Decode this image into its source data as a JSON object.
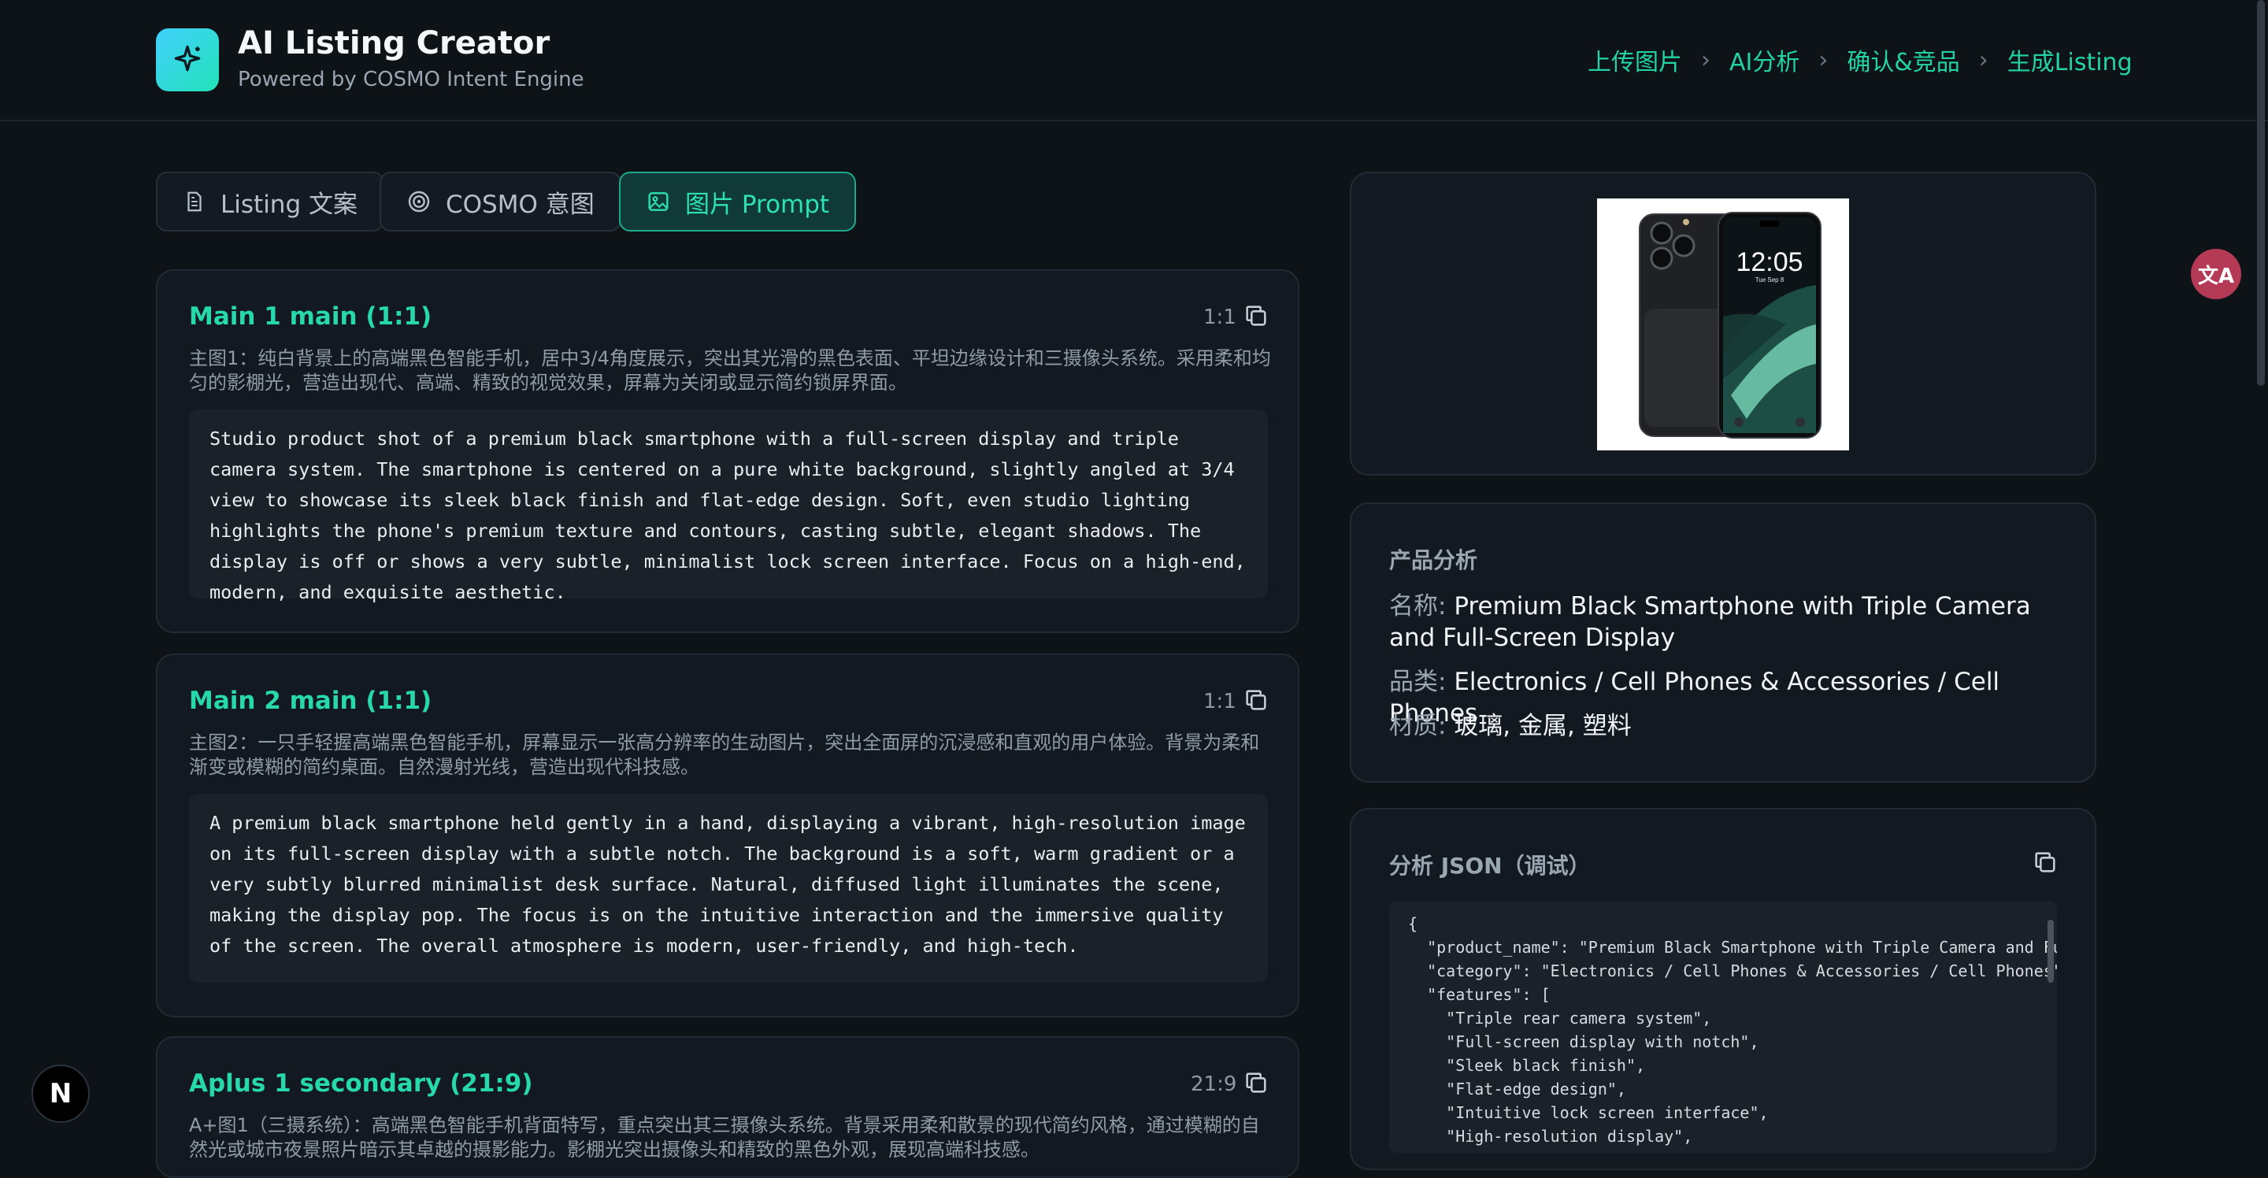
{
  "header": {
    "title": "AI Listing Creator",
    "subtitle": "Powered by COSMO Intent Engine",
    "steps": [
      "上传图片",
      "AI分析",
      "确认&竞品",
      "生成Listing"
    ]
  },
  "tabs": [
    {
      "label": "Listing 文案",
      "icon": "document-icon"
    },
    {
      "label": "COSMO 意图",
      "icon": "target-icon"
    },
    {
      "label": "图片 Prompt",
      "icon": "image-icon",
      "active": true
    }
  ],
  "prompts": [
    {
      "title": "Main 1 main (1:1)",
      "ratio": "1:1",
      "zh": "主图1：纯白背景上的高端黑色智能手机，居中3/4角度展示，突出其光滑的黑色表面、平坦边缘设计和三摄像头系统。采用柔和均匀的影棚光，营造出现代、高端、精致的视觉效果，屏幕为关闭或显示简约锁屏界面。",
      "en": "Studio product shot of a premium black smartphone with a full-screen display and triple camera system. The smartphone is centered on a pure white background, slightly angled at 3/4 view to showcase its sleek black finish and flat-edge design. Soft, even studio lighting highlights the phone's premium texture and contours, casting subtle, elegant shadows. The display is off or shows a very subtle, minimalist lock screen interface. Focus on a high-end, modern, and exquisite aesthetic."
    },
    {
      "title": "Main 2 main (1:1)",
      "ratio": "1:1",
      "zh": "主图2：一只手轻握高端黑色智能手机，屏幕显示一张高分辨率的生动图片，突出全面屏的沉浸感和直观的用户体验。背景为柔和渐变或模糊的简约桌面。自然漫射光线，营造出现代科技感。",
      "en": "A premium black smartphone held gently in a hand, displaying a vibrant, high-resolution image on its full-screen display with a subtle notch. The background is a soft, warm gradient or a very subtly blurred minimalist desk surface. Natural, diffused light illuminates the scene, making the display pop. The focus is on the intuitive interaction and the immersive quality of the screen. The overall atmosphere is modern, user-friendly, and high-tech."
    },
    {
      "title": "Aplus 1 secondary (21:9)",
      "ratio": "21:9",
      "zh": "A+图1（三摄系统）：高端黑色智能手机背面特写，重点突出其三摄像头系统。背景采用柔和散景的现代简约风格，通过模糊的自然光或城市夜景照片暗示其卓越的摄影能力。影棚光突出摄像头和精致的黑色外观，展现高端科技感。"
    }
  ],
  "product": {
    "phone_time": "12:05",
    "phone_date": "Tue Sep 8"
  },
  "analysis": {
    "section_title": "产品分析",
    "name_label": "名称:",
    "name_value": "Premium Black Smartphone with Triple Camera and Full-Screen Display",
    "category_label": "品类:",
    "category_value": "Electronics / Cell Phones & Accessories / Cell Phones",
    "material_label": "材质:",
    "material_value": "玻璃, 金属, 塑料"
  },
  "json_panel": {
    "title": "分析 JSON（调试）",
    "lines": [
      "{",
      "  \"product_name\": \"Premium Black Smartphone with Triple Camera and Full-S",
      "  \"category\": \"Electronics / Cell Phones & Accessories / Cell Phones\",",
      "  \"features\": [",
      "    \"Triple rear camera system\",",
      "    \"Full-screen display with notch\",",
      "    \"Sleek black finish\",",
      "    \"Flat-edge design\",",
      "    \"Intuitive lock screen interface\",",
      "    \"High-resolution display\","
    ]
  },
  "fab": {
    "translate": "文A",
    "next": "N"
  }
}
